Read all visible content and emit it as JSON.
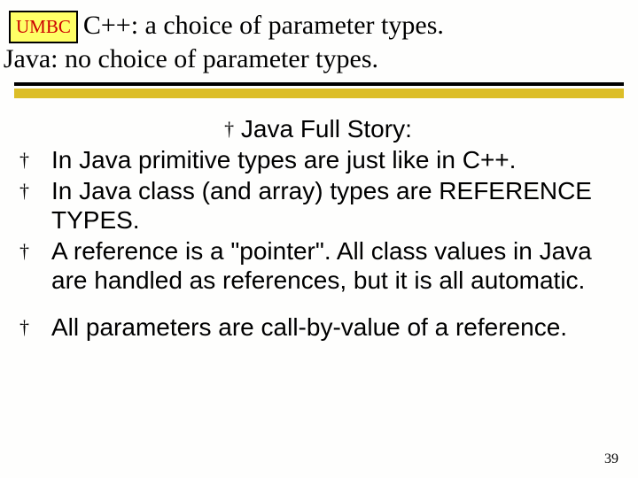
{
  "logo": "UMBC",
  "title_line1": "C++: a choice of parameter types.",
  "title_line2": "Java: no choice of parameter types.",
  "lead": "Java Full Story:",
  "bullets": [
    "In Java primitive types are just like in C++.",
    "In Java class (and array) types are REFERENCE TYPES.",
    "A reference is a \"pointer\". All class values in Java are handled as references, but it is all automatic."
  ],
  "final": "All parameters are call-by-value of a reference.",
  "dagger": "†",
  "page_number": "39"
}
